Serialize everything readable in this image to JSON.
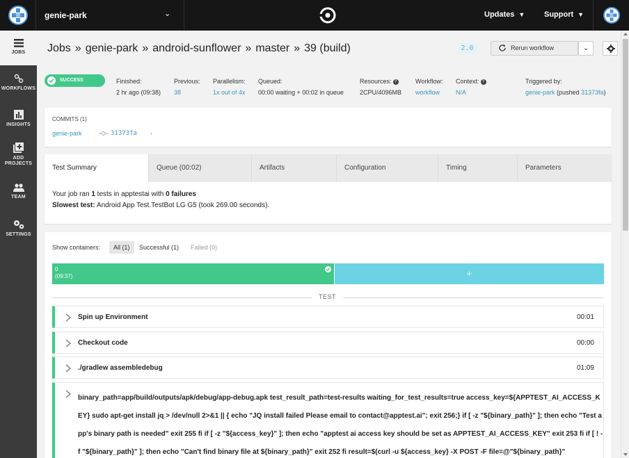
{
  "topbar": {
    "org_name": "genie-park",
    "updates_label": "Updates",
    "support_label": "Support",
    "logo_icon": "circleci-logo-icon"
  },
  "sidebar": {
    "items": [
      {
        "label": "JOBS",
        "icon": "list-icon",
        "active": true
      },
      {
        "label": "WORKFLOWS",
        "icon": "workflow-icon"
      },
      {
        "label": "INSIGHTS",
        "icon": "bar-chart-icon"
      },
      {
        "label_line1": "ADD",
        "label_line2": "PROJECTS",
        "icon": "add-box-icon"
      },
      {
        "label": "TEAM",
        "icon": "team-icon"
      },
      {
        "label": "SETTINGS",
        "icon": "gears-icon"
      }
    ]
  },
  "breadcrumb": {
    "jobs": "Jobs",
    "org": "genie-park",
    "project": "android-sunflower",
    "branch": "master",
    "build": "39 (build)",
    "separator": "»"
  },
  "header": {
    "version": "2.0",
    "rerun_label": "Rerun workflow"
  },
  "status": {
    "badge": "SUCCESS",
    "finished_label": "Finished:",
    "finished_value": "2 hr ago (09:38)",
    "previous_label": "Previous:",
    "previous_value": "38",
    "parallelism_label": "Parallelism:",
    "parallelism_value": "1x out of 4x",
    "queued_label": "Queued:",
    "queued_value": "00:00 waiting + 00:02 in queue",
    "resources_label": "Resources:",
    "resources_value": "2CPU/4096MB",
    "workflow_label": "Workflow:",
    "workflow_value": "workflow",
    "context_label": "Context:",
    "context_value": "N/A",
    "triggered_label": "Triggered by:",
    "triggered_user": "genie-park",
    "triggered_pushed": "(pushed ",
    "triggered_hash": "31373fa",
    "triggered_close": ")"
  },
  "commits": {
    "title": "COMMITS (1)",
    "author": "genie-park",
    "hash": "31373fa",
    "message": "."
  },
  "tabs": [
    {
      "label": "Test Summary",
      "active": true
    },
    {
      "label": "Queue (00:02)"
    },
    {
      "label": "Artifacts"
    },
    {
      "label": "Configuration"
    },
    {
      "label": "Timing"
    },
    {
      "label": "Parameters"
    }
  ],
  "summary": {
    "line1_a": "Your job ran ",
    "line1_b": "1",
    "line1_c": " tests in apptestai with ",
    "line1_d": "0 failures",
    "line2_a": "Slowest test:",
    "line2_b": " Android App Test.TestBot LG G5 (took 269.00 seconds)."
  },
  "containers": {
    "show_label": "Show containers:",
    "filter_all": "All (1)",
    "filter_successful": "Successful (1)",
    "filter_failed": "Failed (0)",
    "container_index": "0",
    "container_time": "(09:37)",
    "add_label": "+",
    "colors": {
      "success": "#42c88a",
      "pending": "#6cd3e4"
    }
  },
  "section_label": "TEST",
  "steps": [
    {
      "name": "Spin up Environment",
      "time": "00:01"
    },
    {
      "name": "Checkout code",
      "time": "00:00"
    },
    {
      "name": "./gradlew assembledebug",
      "time": "01:09"
    }
  ],
  "long_step": {
    "command": "binary_path=app/build/outputs/apk/debug/app-debug.apk test_result_path=test-results waiting_for_test_results=true access_key=${APPTEST_AI_ACCESS_KEY} sudo apt-get install jq > /dev/null 2>&1 || { echo \"JQ install failed Please email to contact@apptest.ai\"; exit 256;} if [ -z \"${binary_path}\" ]; then echo \"Test app's binary path is needed\" exit 255 fi if [ -z \"${access_key}\" ]; then echo \"apptest ai access key should be set as APPTEST_AI_ACCESS_KEY\" exit 253 fi if [ ! -f \"${binary_path}\" ]; then echo \"Can't find binary file at ${binary_path}\" exit 252 fi result=$(curl -u ${access_key} -X POST -F file=@\"${binary_path}\""
  }
}
